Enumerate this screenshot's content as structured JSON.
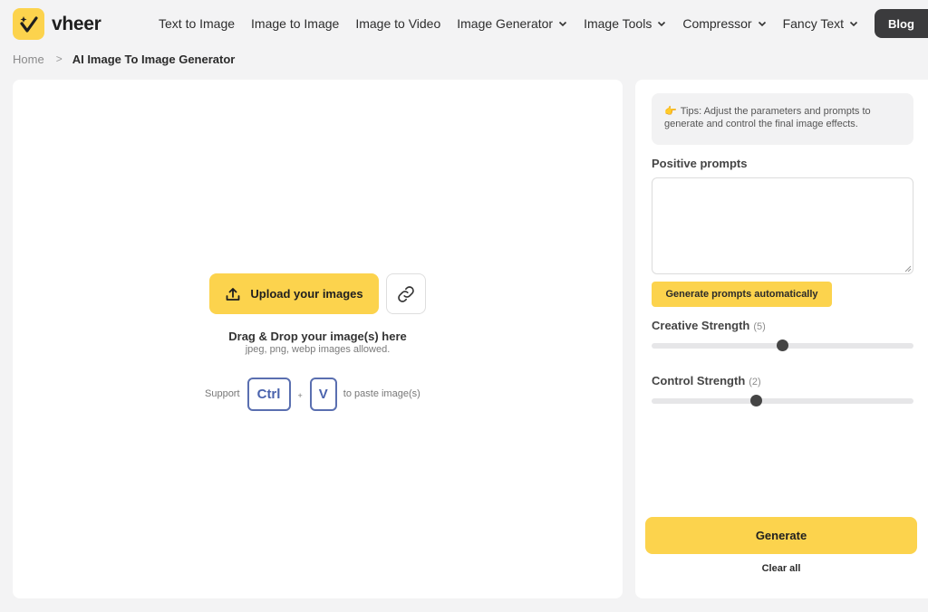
{
  "brand": {
    "name": "vheer",
    "accent": "#fcd34d"
  },
  "nav": {
    "items": [
      {
        "label": "Text to Image",
        "dropdown": false
      },
      {
        "label": "Image to Image",
        "dropdown": false
      },
      {
        "label": "Image to Video",
        "dropdown": false
      },
      {
        "label": "Image Generator",
        "dropdown": true
      },
      {
        "label": "Image Tools",
        "dropdown": true
      },
      {
        "label": "Compressor",
        "dropdown": true
      },
      {
        "label": "Fancy Text",
        "dropdown": true
      }
    ],
    "blog_label": "Blog"
  },
  "breadcrumb": {
    "home": "Home",
    "separator": ">",
    "current": "AI Image To Image Generator"
  },
  "upload": {
    "button_label": "Upload your images",
    "drag_title": "Drag & Drop your image(s) here",
    "drag_sub": "jpeg, png, webp images allowed.",
    "paste_prefix": "Support",
    "key_ctrl": "Ctrl",
    "plus": "+",
    "key_v": "V",
    "paste_suffix": "to paste image(s)"
  },
  "settings": {
    "tips_icon": "👉",
    "tips_text": "Tips: Adjust the parameters and prompts to generate and control the final image effects.",
    "positive_prompts_label": "Positive prompts",
    "positive_prompts_value": "",
    "generate_prompts_label": "Generate prompts automatically",
    "creative_strength": {
      "label": "Creative Strength",
      "value_display": "(5)",
      "value": 5,
      "max": 10
    },
    "control_strength": {
      "label": "Control Strength",
      "value_display": "(2)",
      "value": 2,
      "max": 5
    },
    "generate_label": "Generate",
    "clear_label": "Clear all"
  }
}
